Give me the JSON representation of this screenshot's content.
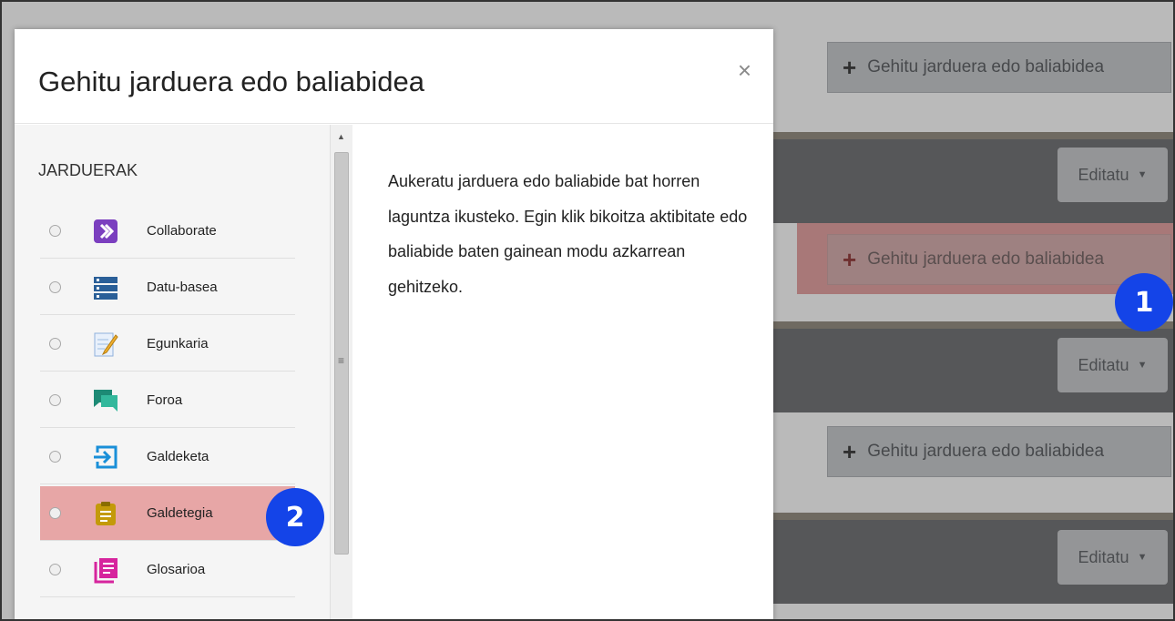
{
  "modal": {
    "title": "Gehitu jarduera edo baliabidea",
    "close": "×",
    "category_header": "JARDUERAK",
    "description": "Aukeratu jarduera edo baliabide bat horren laguntza ikusteko. Egin klik bikoitza aktibitate edo baliabide baten gainean modu azkarrean gehitzeko.",
    "activities": [
      {
        "label": "Collaborate",
        "icon": "collaborate-icon"
      },
      {
        "label": "Datu-basea",
        "icon": "database-icon"
      },
      {
        "label": "Egunkaria",
        "icon": "journal-icon"
      },
      {
        "label": "Foroa",
        "icon": "forum-icon"
      },
      {
        "label": "Galdeketa",
        "icon": "choice-icon"
      },
      {
        "label": "Galdetegia",
        "icon": "quiz-icon",
        "highlighted": true
      },
      {
        "label": "Glosarioa",
        "icon": "glossary-icon"
      }
    ]
  },
  "background": {
    "add_button_label": "Gehitu jarduera edo baliabidea",
    "edit_button_label": "Editatu",
    "plus": "+",
    "caret": "▼"
  },
  "callouts": {
    "one": "1",
    "two": "2"
  },
  "colors": {
    "badge": "#1444e8",
    "highlight": "#e7a6a6"
  }
}
